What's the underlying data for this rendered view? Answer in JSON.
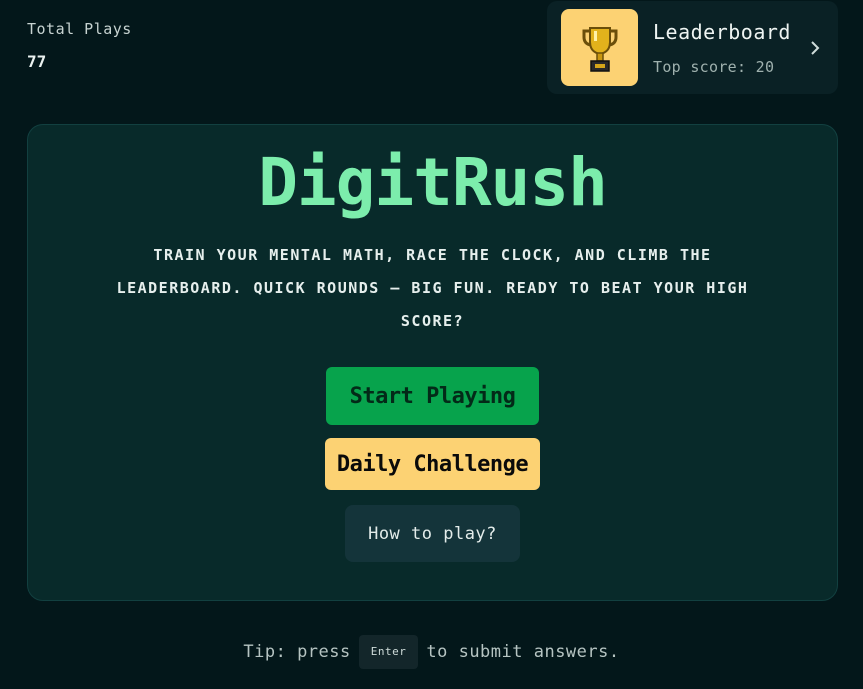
{
  "stats": {
    "label": "Total Plays",
    "value": "77"
  },
  "leaderboard": {
    "icon": "trophy-icon",
    "title": "Leaderboard",
    "subtitle": "Top score: 20",
    "chevron": "chevron-right-icon"
  },
  "main": {
    "title": "DigitRush",
    "tagline": "Train your mental math, race the clock, and climb the leaderboard. Quick rounds — big fun. Ready to beat your high score?",
    "start_label": "Start Playing",
    "daily_label": "Daily Challenge",
    "howto_label": "How to play?"
  },
  "tip": {
    "before": "Tip: press",
    "key": "Enter",
    "after": "to submit answers."
  },
  "colors": {
    "background": "#03171a",
    "card": "#082a2a",
    "title_green": "#7cedac",
    "start_button": "#07a34c",
    "daily_button": "#fcd273",
    "trophy_bg": "#fcd273"
  }
}
